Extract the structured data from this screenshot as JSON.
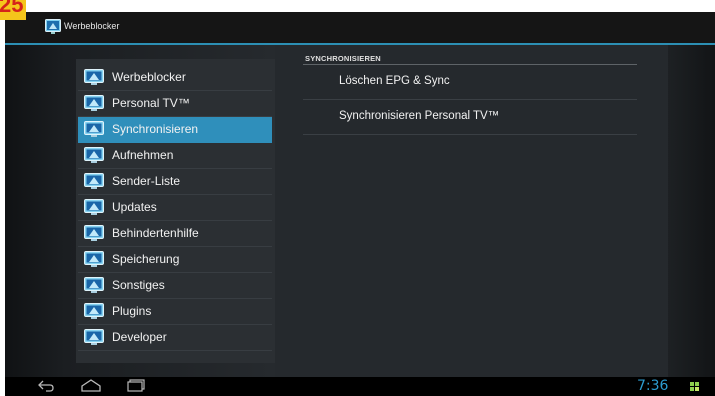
{
  "figure_badge": "25",
  "actionbar": {
    "title": "Werbeblocker"
  },
  "sidebar": {
    "items": [
      {
        "label": "Werbeblocker",
        "selected": false
      },
      {
        "label": "Personal TV™",
        "selected": false
      },
      {
        "label": "Synchronisieren",
        "selected": true
      },
      {
        "label": "Aufnehmen",
        "selected": false
      },
      {
        "label": "Sender-Liste",
        "selected": false
      },
      {
        "label": "Updates",
        "selected": false
      },
      {
        "label": "Behindertenhilfe",
        "selected": false
      },
      {
        "label": "Speicherung",
        "selected": false
      },
      {
        "label": "Sonstiges",
        "selected": false
      },
      {
        "label": "Plugins",
        "selected": false
      },
      {
        "label": "Developer",
        "selected": false
      }
    ]
  },
  "detail": {
    "section_header": "SYNCHRONISIEREN",
    "items": [
      {
        "label": "Löschen EPG & Sync"
      },
      {
        "label": "Synchronisieren Personal TV™"
      }
    ]
  },
  "navbar": {
    "back": "back-icon",
    "home": "home-icon",
    "recents": "recents-icon"
  },
  "status": {
    "clock": "7:36"
  },
  "colors": {
    "accent": "#2f8fbb",
    "badge_bg": "#f5c51b",
    "badge_text": "#d5231a"
  }
}
